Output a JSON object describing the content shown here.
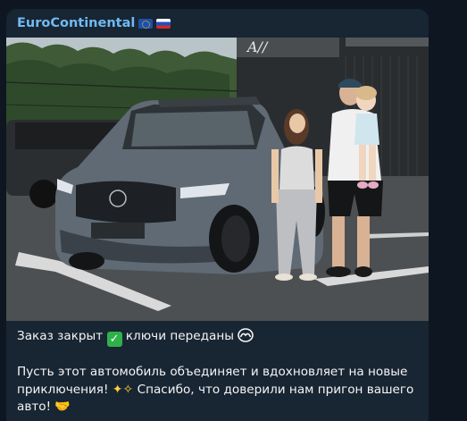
{
  "message": {
    "channel_name": "EuroContinental",
    "flags": [
      "eu-flag-icon",
      "russia-flag-icon"
    ],
    "photo_alt": "",
    "caption": {
      "line1_prefix": "Заказ закрыт",
      "line1_check_emoji": "✅",
      "line1_suffix": "ключи переданы",
      "para2_part1": "Пусть этот автомобиль объединяет и вдохновляет на новые приключения!",
      "para2_sparkles": "✨",
      "para2_part2": "Спасибо, что доверили нам пригон вашего авто!",
      "para2_handshake": "🤝"
    }
  },
  "colors": {
    "background": "#0e1621",
    "bubble": "#182533",
    "channel_name": "#71baf3",
    "text": "#f5f5f5"
  }
}
